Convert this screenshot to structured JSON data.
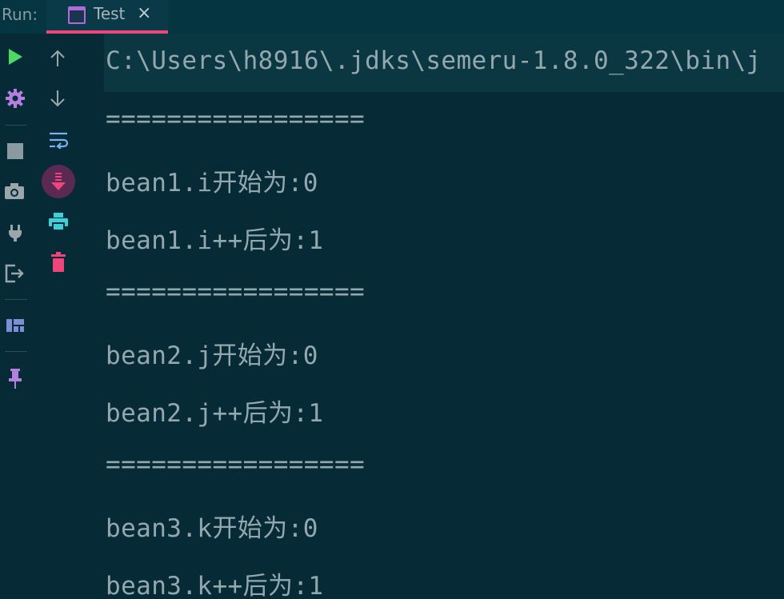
{
  "run_panel": {
    "label": "Run:",
    "tab": {
      "title": "Test",
      "close_glyph": "×",
      "icon": "application-window-icon"
    }
  },
  "toolbar": {
    "left": [
      {
        "name": "run-icon",
        "color": "#4cd964"
      },
      {
        "name": "settings-gear-icon",
        "color": "#b57fe0"
      },
      {
        "name": "stop-icon",
        "color": "#8a9aa1"
      },
      {
        "name": "camera-icon",
        "color": "#9aa6ab"
      },
      {
        "name": "plug-icon",
        "color": "#9aa6ab"
      },
      {
        "name": "exit-icon",
        "color": "#9aa6ab"
      },
      {
        "name": "layout-icon",
        "color": "#7f8fd6"
      },
      {
        "name": "pin-icon",
        "color": "#b57fe0"
      }
    ],
    "right": [
      {
        "name": "arrow-up-icon",
        "color": "#9aa6ab"
      },
      {
        "name": "arrow-down-icon",
        "color": "#9aa6ab"
      },
      {
        "name": "soft-wrap-icon",
        "color": "#7ab0f0"
      },
      {
        "name": "scroll-to-end-icon",
        "color": "#f0457a"
      },
      {
        "name": "print-icon",
        "color": "#3ed0d8"
      },
      {
        "name": "trash-icon",
        "color": "#f0457a"
      }
    ]
  },
  "console": {
    "command": "C:\\Users\\h8916\\.jdks\\semeru-1.8.0_322\\bin\\j",
    "lines": [
      "=================",
      "bean1.i开始为:0",
      "bean1.i++后为:1",
      "=================",
      "bean2.j开始为:0",
      "bean2.j++后为:1",
      "=================",
      "bean3.k开始为:0",
      "bean3.k++后为:1"
    ]
  }
}
